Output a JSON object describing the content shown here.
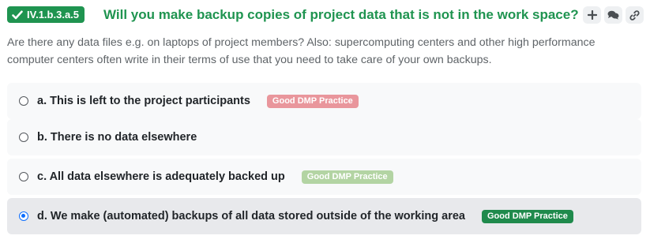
{
  "question": {
    "badge": "IV.1.b.3.a.5",
    "title": "Will you make backup copies of project data that is not in the work space?",
    "description": "Are there any data files e.g. on laptops of project members? Also: supercomputing centers and other high performance computer centers often write in their terms of use that you need to take care of your own backups.",
    "actions": [
      {
        "icon": "plus-icon"
      },
      {
        "icon": "comments-icon"
      },
      {
        "icon": "link-icon"
      }
    ]
  },
  "colors": {
    "accent": "#1f9450",
    "tag_bad": "#e9969c",
    "tag_neutral": "#b3d4a3",
    "tag_good": "#1f8a4c"
  },
  "options": [
    {
      "label": "a. This is left to the project participants",
      "tag": "Good DMP Practice",
      "selected": false
    },
    {
      "label": "b. There is no data elsewhere",
      "tag": "",
      "selected": false
    },
    {
      "label": "c. All data elsewhere is adequately backed up",
      "tag": "Good DMP Practice",
      "selected": false
    },
    {
      "label": "d. We make (automated) backups of all data stored outside of the working area",
      "tag": "Good DMP Practice",
      "selected": true
    }
  ]
}
